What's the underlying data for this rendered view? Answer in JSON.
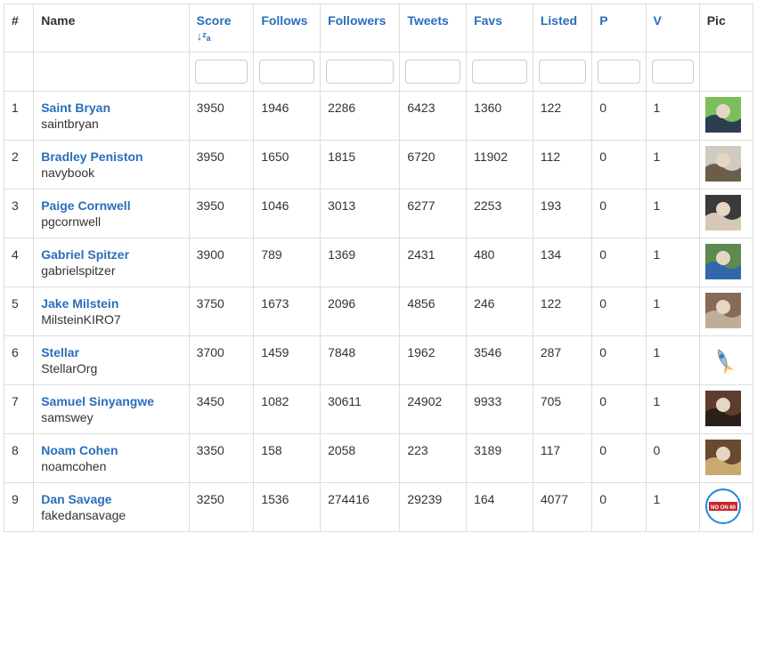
{
  "columns": {
    "idx": "#",
    "name": "Name",
    "score": "Score",
    "follows": "Follows",
    "followers": "Followers",
    "tweets": "Tweets",
    "favs": "Favs",
    "listed": "Listed",
    "p": "P",
    "v": "V",
    "pic": "Pic"
  },
  "sort": {
    "column": "score",
    "direction": "desc",
    "icon": "↓ᶻₐ"
  },
  "rows": [
    {
      "idx": "1",
      "name": "Saint Bryan",
      "handle": "saintbryan",
      "score": "3950",
      "follows": "1946",
      "followers": "2286",
      "tweets": "6423",
      "favs": "1360",
      "listed": "122",
      "p": "0",
      "v": "1",
      "pic": {
        "type": "photo",
        "a": "#7bbf5a",
        "b": "#2c3e50"
      }
    },
    {
      "idx": "2",
      "name": "Bradley Peniston",
      "handle": "navybook",
      "score": "3950",
      "follows": "1650",
      "followers": "1815",
      "tweets": "6720",
      "favs": "11902",
      "listed": "112",
      "p": "0",
      "v": "1",
      "pic": {
        "type": "photo",
        "a": "#cfcac2",
        "b": "#6b5d4a"
      }
    },
    {
      "idx": "3",
      "name": "Paige Cornwell",
      "handle": "pgcornwell",
      "score": "3950",
      "follows": "1046",
      "followers": "3013",
      "tweets": "6277",
      "favs": "2253",
      "listed": "193",
      "p": "0",
      "v": "1",
      "pic": {
        "type": "photo",
        "a": "#3a3a3a",
        "b": "#d6c7b8"
      }
    },
    {
      "idx": "4",
      "name": "Gabriel Spitzer",
      "handle": "gabrielspitzer",
      "score": "3900",
      "follows": "789",
      "followers": "1369",
      "tweets": "2431",
      "favs": "480",
      "listed": "134",
      "p": "0",
      "v": "1",
      "pic": {
        "type": "photo",
        "a": "#5c8a4f",
        "b": "#3366aa"
      }
    },
    {
      "idx": "5",
      "name": "Jake Milstein",
      "handle": "MilsteinKIRO7",
      "score": "3750",
      "follows": "1673",
      "followers": "2096",
      "tweets": "4856",
      "favs": "246",
      "listed": "122",
      "p": "0",
      "v": "1",
      "pic": {
        "type": "photo",
        "a": "#876b57",
        "b": "#bfae97"
      }
    },
    {
      "idx": "6",
      "name": "Stellar",
      "handle": "StellarOrg",
      "score": "3700",
      "follows": "1459",
      "followers": "7848",
      "tweets": "1962",
      "favs": "3546",
      "listed": "287",
      "p": "0",
      "v": "1",
      "pic": {
        "type": "rocket"
      }
    },
    {
      "idx": "7",
      "name": "Samuel Sinyangwe",
      "handle": "samswey",
      "score": "3450",
      "follows": "1082",
      "followers": "30611",
      "tweets": "24902",
      "favs": "9933",
      "listed": "705",
      "p": "0",
      "v": "1",
      "pic": {
        "type": "photo",
        "a": "#5e3c2e",
        "b": "#2a1f1a"
      }
    },
    {
      "idx": "8",
      "name": "Noam Cohen",
      "handle": "noamcohen",
      "score": "3350",
      "follows": "158",
      "followers": "2058",
      "tweets": "223",
      "favs": "3189",
      "listed": "117",
      "p": "0",
      "v": "0",
      "pic": {
        "type": "photo",
        "a": "#6a4a2e",
        "b": "#caa96e"
      }
    },
    {
      "idx": "9",
      "name": "Dan Savage",
      "handle": "fakedansavage",
      "score": "3250",
      "follows": "1536",
      "followers": "274416",
      "tweets": "29239",
      "favs": "164",
      "listed": "4077",
      "p": "0",
      "v": "1",
      "pic": {
        "type": "badge",
        "text1": "NO ON 60",
        "a": "#c62828",
        "b": "#1e88e5"
      }
    }
  ]
}
